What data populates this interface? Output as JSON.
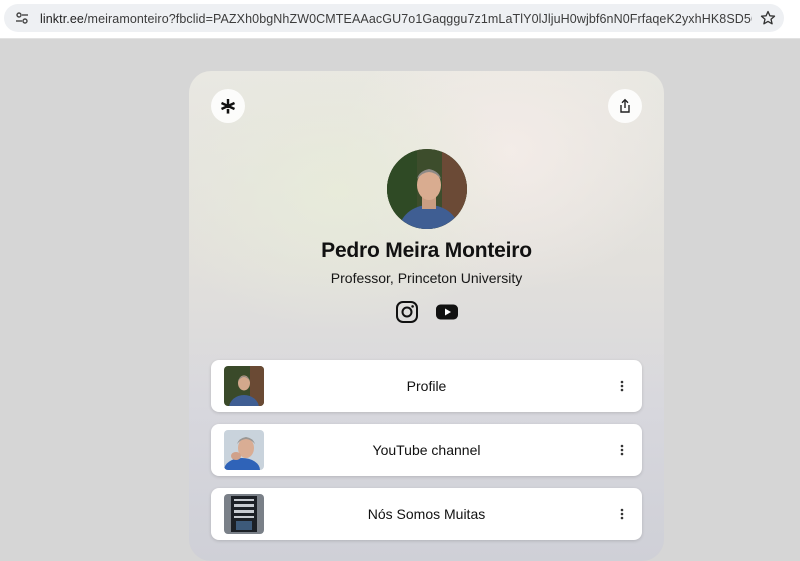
{
  "browser": {
    "url_host": "linktr.ee",
    "url_rest": "/meiramonteiro?fbclid=PAZXh0bgNhZW0CMTEAAacGU7o1Gaqggu7z1mLaTlY0lJljuH0wjbf6nN0FrfaqeK2yxhHK8SD56xs3bA_aem_8..."
  },
  "profile": {
    "name": "Pedro Meira Monteiro",
    "bio": "Professor, Princeton University"
  },
  "socials": [
    {
      "icon": "instagram-icon"
    },
    {
      "icon": "youtube-icon"
    }
  ],
  "links": [
    {
      "label": "Profile"
    },
    {
      "label": "YouTube channel"
    },
    {
      "label": "Nós Somos Muitas"
    }
  ]
}
